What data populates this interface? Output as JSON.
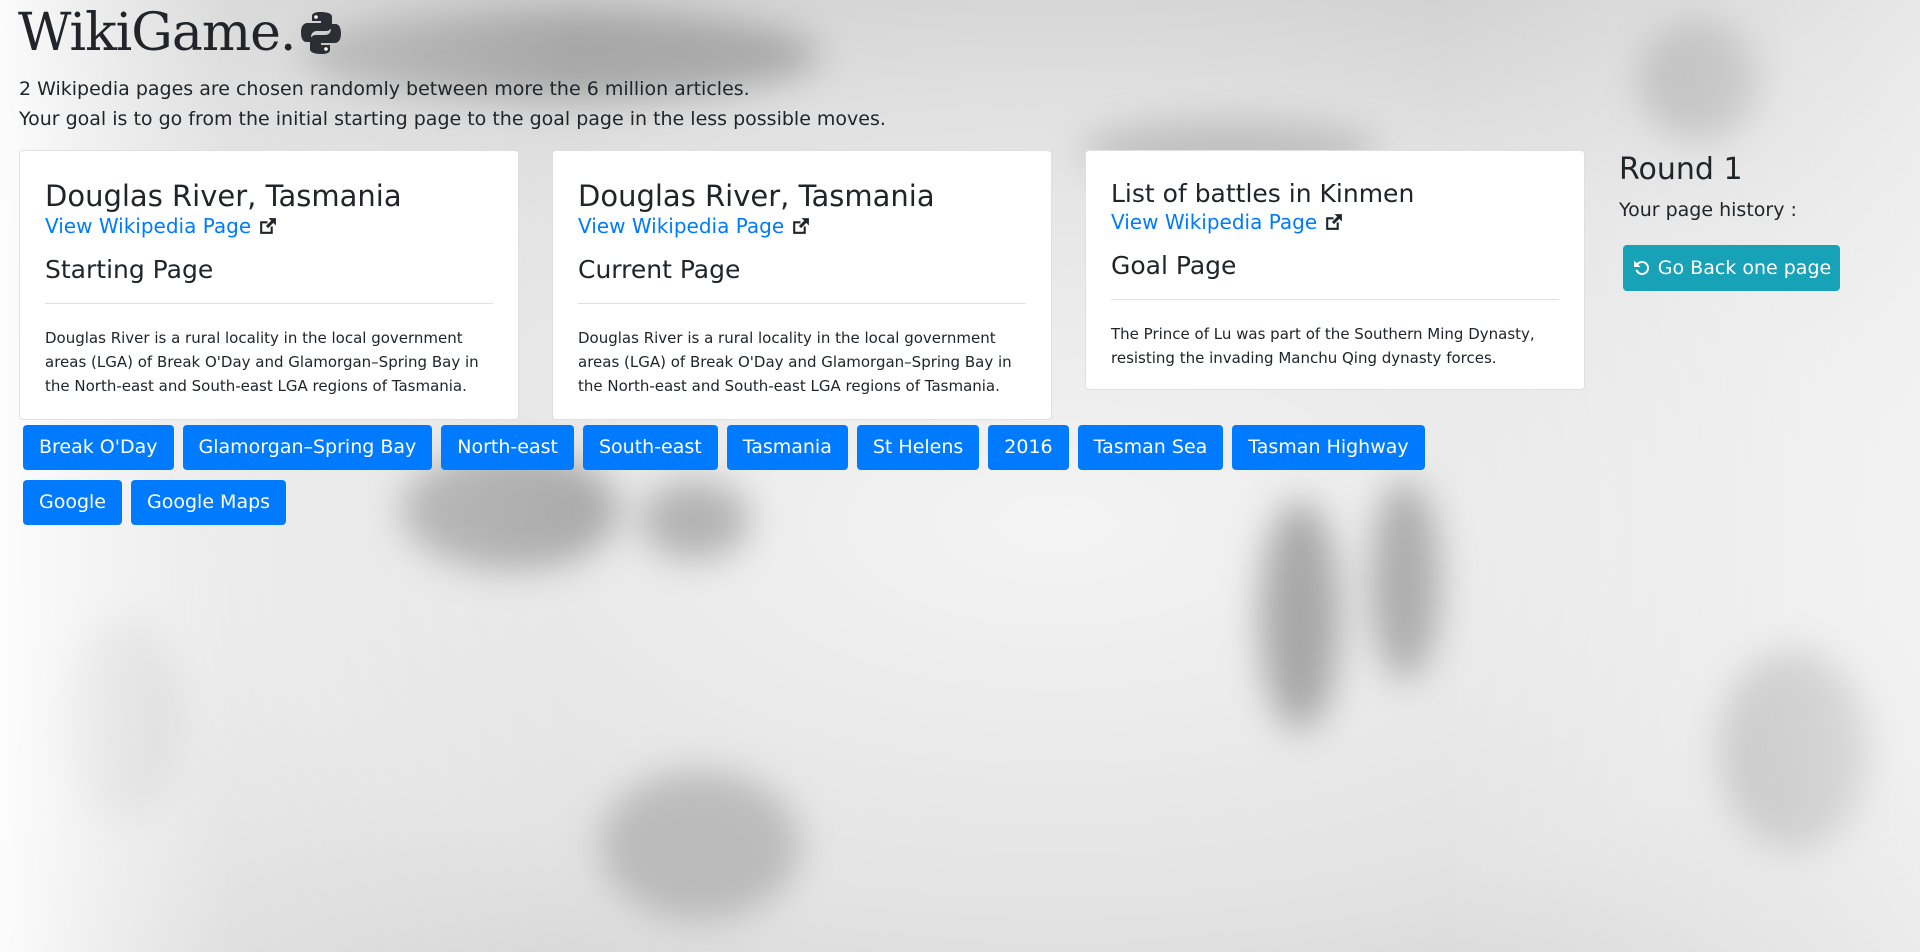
{
  "app": {
    "title": "WikiGame.",
    "intro_line1": "2 Wikipedia pages are chosen randomly between more the 6 million articles.",
    "intro_line2": "Your goal is to go from the initial starting page to the goal page in the less possible moves."
  },
  "cards": [
    {
      "title": "Douglas River, Tasmania",
      "link_label": "View Wikipedia Page",
      "subtitle": "Starting Page",
      "description": "Douglas River is a rural locality in the local government areas (LGA) of Break O'Day and Glamorgan–Spring Bay in the North-east and South-east LGA regions of Tasmania."
    },
    {
      "title": "Douglas River, Tasmania",
      "link_label": "View Wikipedia Page",
      "subtitle": "Current Page",
      "description": "Douglas River is a rural locality in the local government areas (LGA) of Break O'Day and Glamorgan–Spring Bay in the North-east and South-east LGA regions of Tasmania."
    },
    {
      "title": "List of battles in Kinmen",
      "link_label": "View Wikipedia Page",
      "subtitle": "Goal Page",
      "description": "The Prince of Lu was part of the Southern Ming Dynasty, resisting the invading Manchu Qing dynasty forces."
    }
  ],
  "sidebar": {
    "round": "Round 1",
    "history_label": "Your page history :",
    "back_button": "Go Back one page"
  },
  "link_buttons": [
    "Break O'Day",
    "Glamorgan–Spring Bay",
    "North-east",
    "South-east",
    "Tasmania",
    "St Helens",
    "2016",
    "Tasman Sea",
    "Tasman Highway",
    "Google",
    "Google Maps"
  ],
  "colors": {
    "primary": "#007bff",
    "info": "#17a2b8"
  },
  "icons": {
    "brand": "python-logo-icon",
    "external_link": "external-link-icon",
    "undo": "undo-icon"
  }
}
